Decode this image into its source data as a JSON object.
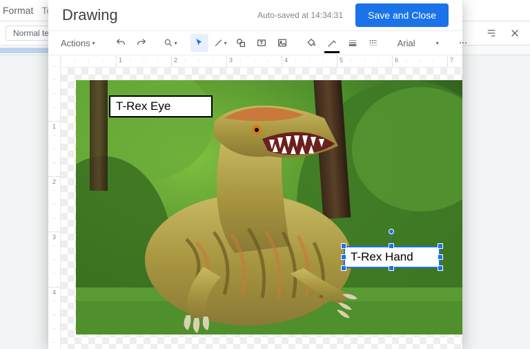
{
  "docs": {
    "menu": {
      "format": "Format",
      "tools": "Tools"
    },
    "style_label": "Normal text"
  },
  "modal": {
    "title": "Drawing",
    "autosave": "Auto-saved at 14:34:31",
    "save_btn": "Save and Close"
  },
  "toolbar": {
    "actions": "Actions",
    "font": "Arial"
  },
  "ruler": {
    "h": [
      "1",
      "2",
      "3",
      "4",
      "5",
      "6",
      "7"
    ],
    "v": [
      "1",
      "2",
      "3",
      "4"
    ]
  },
  "labels": {
    "eye": "T-Rex Eye",
    "hand": "T-Rex Hand"
  }
}
